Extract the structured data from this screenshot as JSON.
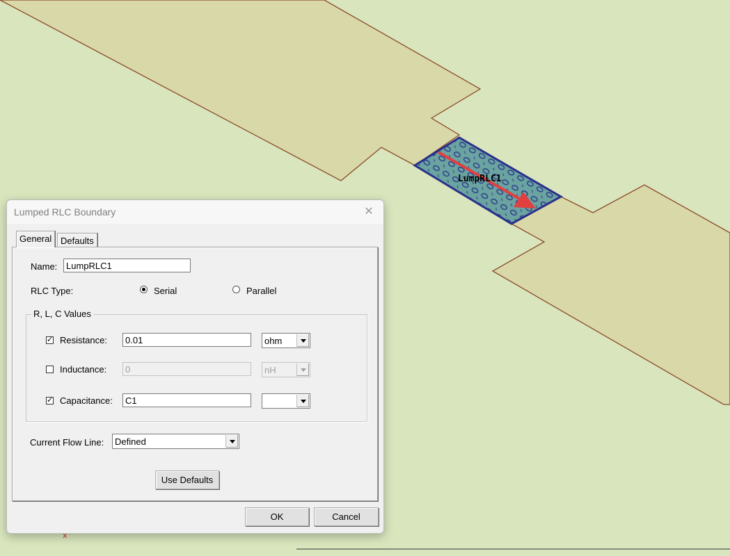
{
  "viewport": {
    "port_label": "LumpRLC1",
    "background_color": "#d9e6bd",
    "trace_color": "#d8d8a8",
    "trace_outline": "#8b4a2b",
    "port_fill": "#5e9a9a",
    "port_outline": "#2b2f8c",
    "arrow_color": "#e04040"
  },
  "dialog": {
    "title": "Lumped RLC Boundary",
    "close_glyph": "✕",
    "tabs": [
      {
        "label": "General",
        "active": true
      },
      {
        "label": "Defaults",
        "active": false
      }
    ],
    "name_label": "Name:",
    "name_value": "LumpRLC1",
    "rlc_type_label": "RLC Type:",
    "rlc_type_options": [
      {
        "label": "Serial",
        "selected": true
      },
      {
        "label": "Parallel",
        "selected": false
      }
    ],
    "values_group_title": "R, L, C Values",
    "resistance": {
      "label": "Resistance:",
      "checked": true,
      "value": "0.01",
      "unit": "ohm"
    },
    "inductance": {
      "label": "Inductance:",
      "checked": false,
      "value": "0",
      "unit": "nH"
    },
    "capacitance": {
      "label": "Capacitance:",
      "checked": true,
      "value": "C1",
      "unit": ""
    },
    "current_flow_label": "Current Flow Line:",
    "current_flow_value": "Defined",
    "use_defaults_label": "Use Defaults",
    "ok_label": "OK",
    "cancel_label": "Cancel"
  }
}
